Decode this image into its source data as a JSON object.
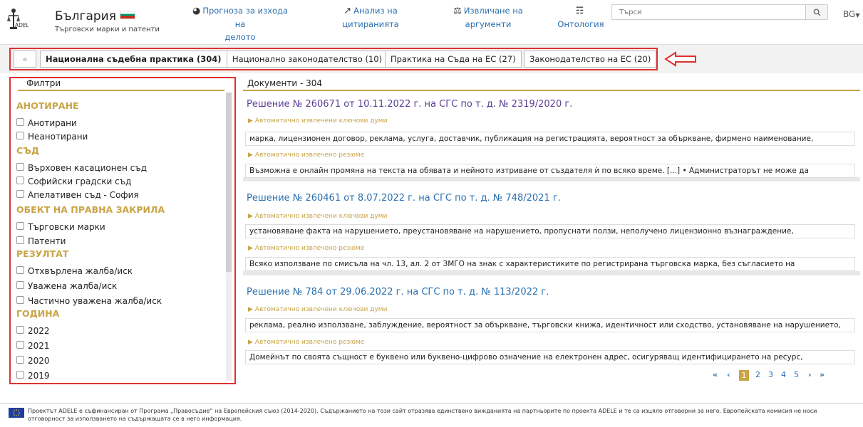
{
  "brand": {
    "title": "България",
    "subtitle": "Търговски марки и патенти",
    "logo_text": "ADELE"
  },
  "nav": [
    {
      "icon": "robot-icon",
      "line1": "Прогноза за изхода на",
      "line2": "делото"
    },
    {
      "icon": "chart-icon",
      "line1": "Анализ на",
      "line2": "цитиранията"
    },
    {
      "icon": "scales-icon",
      "line1": "Извличане на",
      "line2": "аргументи"
    },
    {
      "icon": "hierarchy-icon",
      "line1": "",
      "line2": "Онтология"
    }
  ],
  "search": {
    "placeholder": "Търси"
  },
  "lang": "BG",
  "tabs": {
    "collapse": "«",
    "items": [
      {
        "label": "Национална съдебна практика (304)",
        "active": true
      },
      {
        "label": "Национално законодателство (10)",
        "active": false
      },
      {
        "label": "Практика на Съда на ЕС (27)",
        "active": false
      },
      {
        "label": "Законодателство на ЕС (20)",
        "active": false
      }
    ]
  },
  "filters": {
    "header": "Филтри",
    "groups": [
      {
        "title": "АНОТИРАНЕ",
        "options": [
          "Анотирани",
          "Неанотирани"
        ]
      },
      {
        "title": "СЪД",
        "options": [
          "Върховен касационен съд",
          "Софийски градски съд",
          "Апелативен съд - София"
        ]
      },
      {
        "title": "ОБЕКТ НА ПРАВНА ЗАКРИЛА",
        "options": [
          "Търговски марки",
          "Патенти"
        ]
      },
      {
        "title": "РЕЗУЛТАТ",
        "options": [
          "Отхвърлена жалба/иск",
          "Уважена жалба/иск",
          "Частично уважена жалба/иск"
        ]
      },
      {
        "title": "ГОДИНА",
        "options": [
          "2022",
          "2021",
          "2020",
          "2019"
        ]
      }
    ]
  },
  "documents": {
    "header": "Документи - 304",
    "keywords_label": "Автоматично извлечени ключови думи",
    "summary_label": "Автоматично извлечено резюме",
    "items": [
      {
        "title": "Решение № 260671 от 10.11.2022 г. на СГС по т. д. № 2319/2020 г.",
        "keywords": "марка, лицензионен договор, реклама, услуга, доставчик, публикация на регистрацията, вероятност за объркване, фирмено наименование,",
        "summary": "Възможна е онлайн промяна на текста на обявата и нейното изтриване от създателя ѝ по всяко време. [...] • Администраторът не може да"
      },
      {
        "title": "Решение № 260461 от 8.07.2022 г. на СГС по т. д. № 748/2021 г.",
        "keywords": "установяване факта на нарушението, преустановяване на нарушението, пропуснати ползи, неполучено лицензионно възнаграждение,",
        "summary": "Всяко използване по смисъла на чл. 13, ал. 2 от ЗМГО на знак с характеристиките по регистрирана търговска марка, без съгласието на"
      },
      {
        "title": "Решение № 784 от 29.06.2022 г. на СГС по т. д. № 113/2022 г.",
        "keywords": "реклама, реално използване, заблуждение, вероятност за объркване, търговски книжа, идентичност или сходство, установяване на нарушението,",
        "summary": "Домейнът по своята същност е буквено или буквено-цифрово означение на електронен адрес, осигуряващ идентифицирането на ресурс,"
      }
    ]
  },
  "pagination": {
    "first": "«",
    "prev": "‹",
    "pages": [
      "1",
      "2",
      "3",
      "4",
      "5"
    ],
    "current": "1",
    "next": "›",
    "last": "»"
  },
  "footer": {
    "text": "Проектът ADELE е съфинансиран от Програма „Правосъдие“ на Европейския съюз (2014-2020). Съдържанието на този сайт отразява единствено вижданията на партньорите по проекта ADELE и те са изцяло отговорни за него. Европейската комисия не носи отговорност за използването на съдържащата се в него информация."
  },
  "colors": {
    "accent": "#c9a446",
    "link": "#2a6fb0",
    "highlight": "#e03131"
  }
}
